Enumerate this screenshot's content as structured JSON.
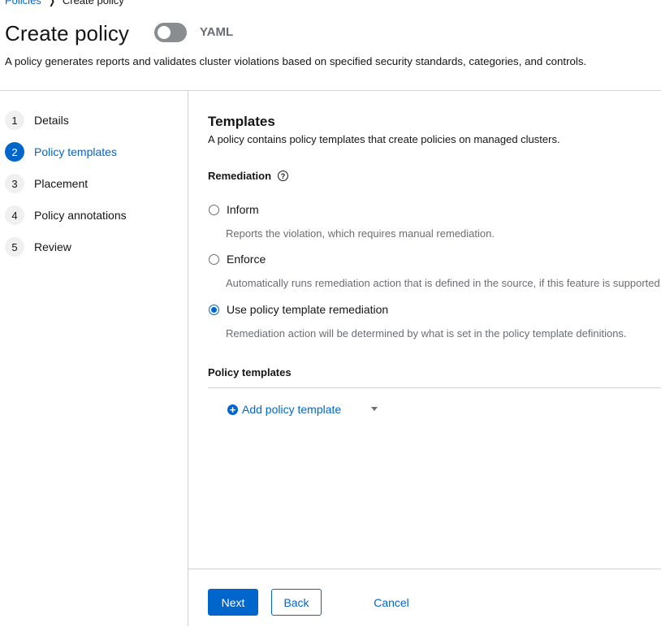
{
  "breadcrumb": {
    "parent": "Policies",
    "separator": "❯",
    "current": "Create policy"
  },
  "header": {
    "title": "Create policy",
    "yaml_label": "YAML",
    "yaml_toggle_on": false,
    "description": "A policy generates reports and validates cluster violations based on specified security standards, categories, and controls."
  },
  "steps": [
    {
      "num": "1",
      "label": "Details",
      "active": false
    },
    {
      "num": "2",
      "label": "Policy templates",
      "active": true
    },
    {
      "num": "3",
      "label": "Placement",
      "active": false
    },
    {
      "num": "4",
      "label": "Policy annotations",
      "active": false
    },
    {
      "num": "5",
      "label": "Review",
      "active": false
    }
  ],
  "main": {
    "title": "Templates",
    "description": "A policy contains policy templates that create policies on managed clusters.",
    "remediation": {
      "label": "Remediation",
      "help_icon": "?",
      "options": [
        {
          "label": "Inform",
          "description": "Reports the violation, which requires manual remediation.",
          "checked": false
        },
        {
          "label": "Enforce",
          "description": "Automatically runs remediation action that is defined in the source, if this feature is supported.",
          "checked": false
        },
        {
          "label": "Use policy template remediation",
          "description": "Remediation action will be determined by what is set in the policy template definitions.",
          "checked": true
        }
      ]
    },
    "policy_templates": {
      "heading": "Policy templates",
      "add_label": "Add policy template",
      "add_icon": "+"
    }
  },
  "footer": {
    "next_label": "Next",
    "back_label": "Back",
    "cancel_label": "Cancel"
  },
  "colors": {
    "accent": "#0066cc",
    "text": "#151515",
    "muted": "#6a6e73",
    "border": "#d2d2d2"
  },
  "icons": {
    "breadcrumb_separator": "chevron-right-icon",
    "help": "question-circle-icon",
    "add": "plus-circle-icon",
    "dropdown": "caret-down-icon"
  }
}
